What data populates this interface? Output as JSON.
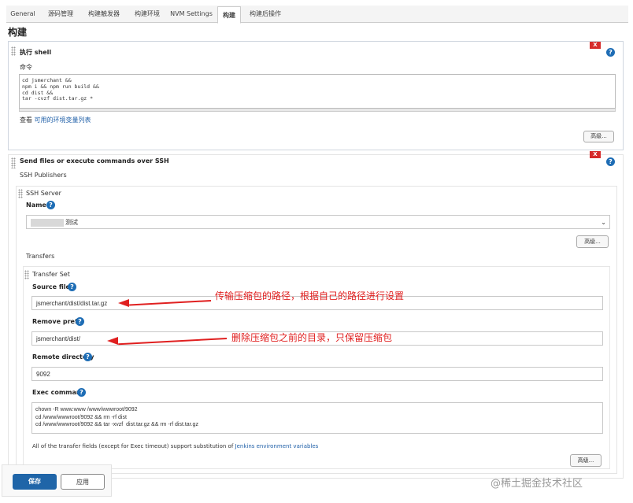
{
  "tabs": [
    {
      "label": "General"
    },
    {
      "label": "源码管理"
    },
    {
      "label": "构建触发器"
    },
    {
      "label": "构建环境"
    },
    {
      "label": "NVM Settings"
    },
    {
      "label": "构建"
    },
    {
      "label": "构建后操作"
    }
  ],
  "active_tab": "构建",
  "page_title": "构建",
  "shell_section": {
    "title": "执行 shell",
    "command_label": "命令",
    "command_lines": [
      "cd jsmerchant &&",
      "npm i && npm run build &&",
      "cd dist &&",
      "tar -cvzf dist.tar.gz *"
    ],
    "env_prefix": "查看",
    "env_link": "可用的环境变量列表",
    "advanced_button": "高级...",
    "close_label": "X",
    "help_label": "?"
  },
  "ssh_section": {
    "title": "Send files or execute commands over SSH",
    "publishers_label": "SSH Publishers",
    "server_label": "SSH Server",
    "name_label": "Name",
    "name_value": "测试",
    "advanced_button": "高级...",
    "transfers_label": "Transfers",
    "transfer_set_label": "Transfer Set",
    "source_files_label": "Source files",
    "source_files_value": "jsmerchant/dist/dist.tar.gz",
    "remove_prefix_label": "Remove prefix",
    "remove_prefix_value": "jsmerchant/dist/",
    "remote_directory_label": "Remote directory",
    "remote_directory_value": "9092",
    "exec_command_label": "Exec command",
    "exec_command_lines": [
      "chown -R www:www /www/wwwroot/9092",
      "cd /www/wwwroot/9092 && rm -rf dist",
      "cd /www/wwwroot/9092 && tar -xvzf  dist.tar.gz && rm -rf dist.tar.gz"
    ],
    "note_text": "All of the transfer fields (except for Exec timeout) support substitution of",
    "note_link": "Jenkins environment variables",
    "transfer_advanced_button": "高级...",
    "close_label": "X",
    "help_label": "?"
  },
  "annotations": {
    "source_note": "传输压缩包的路径，根据自己的路径进行设置",
    "prefix_note": "删除压缩包之前的目录，只保留压缩包"
  },
  "footer": {
    "save_label": "保存",
    "apply_label": "应用"
  },
  "watermark": "@稀土掘金技术社区",
  "colors": {
    "accent_blue": "#1f65a8",
    "annotation_red": "#e02020",
    "close_red": "#d62b2b"
  }
}
